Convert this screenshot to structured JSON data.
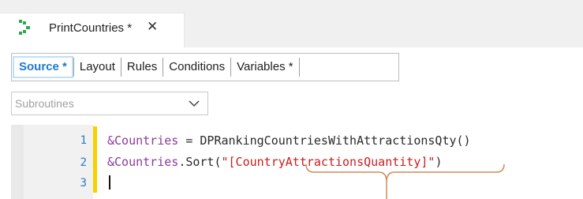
{
  "tab": {
    "title": "PrintCountries *",
    "close": "✕"
  },
  "parts": [
    {
      "label": "Source *",
      "active": true
    },
    {
      "label": "Layout"
    },
    {
      "label": "Rules"
    },
    {
      "label": "Conditions"
    },
    {
      "label": "Variables *"
    }
  ],
  "combo": {
    "value": "Subroutines"
  },
  "editor": {
    "lines": [
      {
        "num": "1",
        "var": "&Countries",
        "rest": " = DPRankingCountriesWithAttractionsQty()"
      },
      {
        "num": "2",
        "var": "&Countries",
        "mid": ".Sort(",
        "str": "\"[CountryAttractionsQuantity]\"",
        "end": ")"
      },
      {
        "num": "3",
        "text": ""
      }
    ]
  },
  "colors": {
    "accent": "#1f7ad1",
    "change_bar": "#f5d200",
    "string": "#c81e1e",
    "variable": "#8b3a9c",
    "brace": "#d08a56"
  }
}
